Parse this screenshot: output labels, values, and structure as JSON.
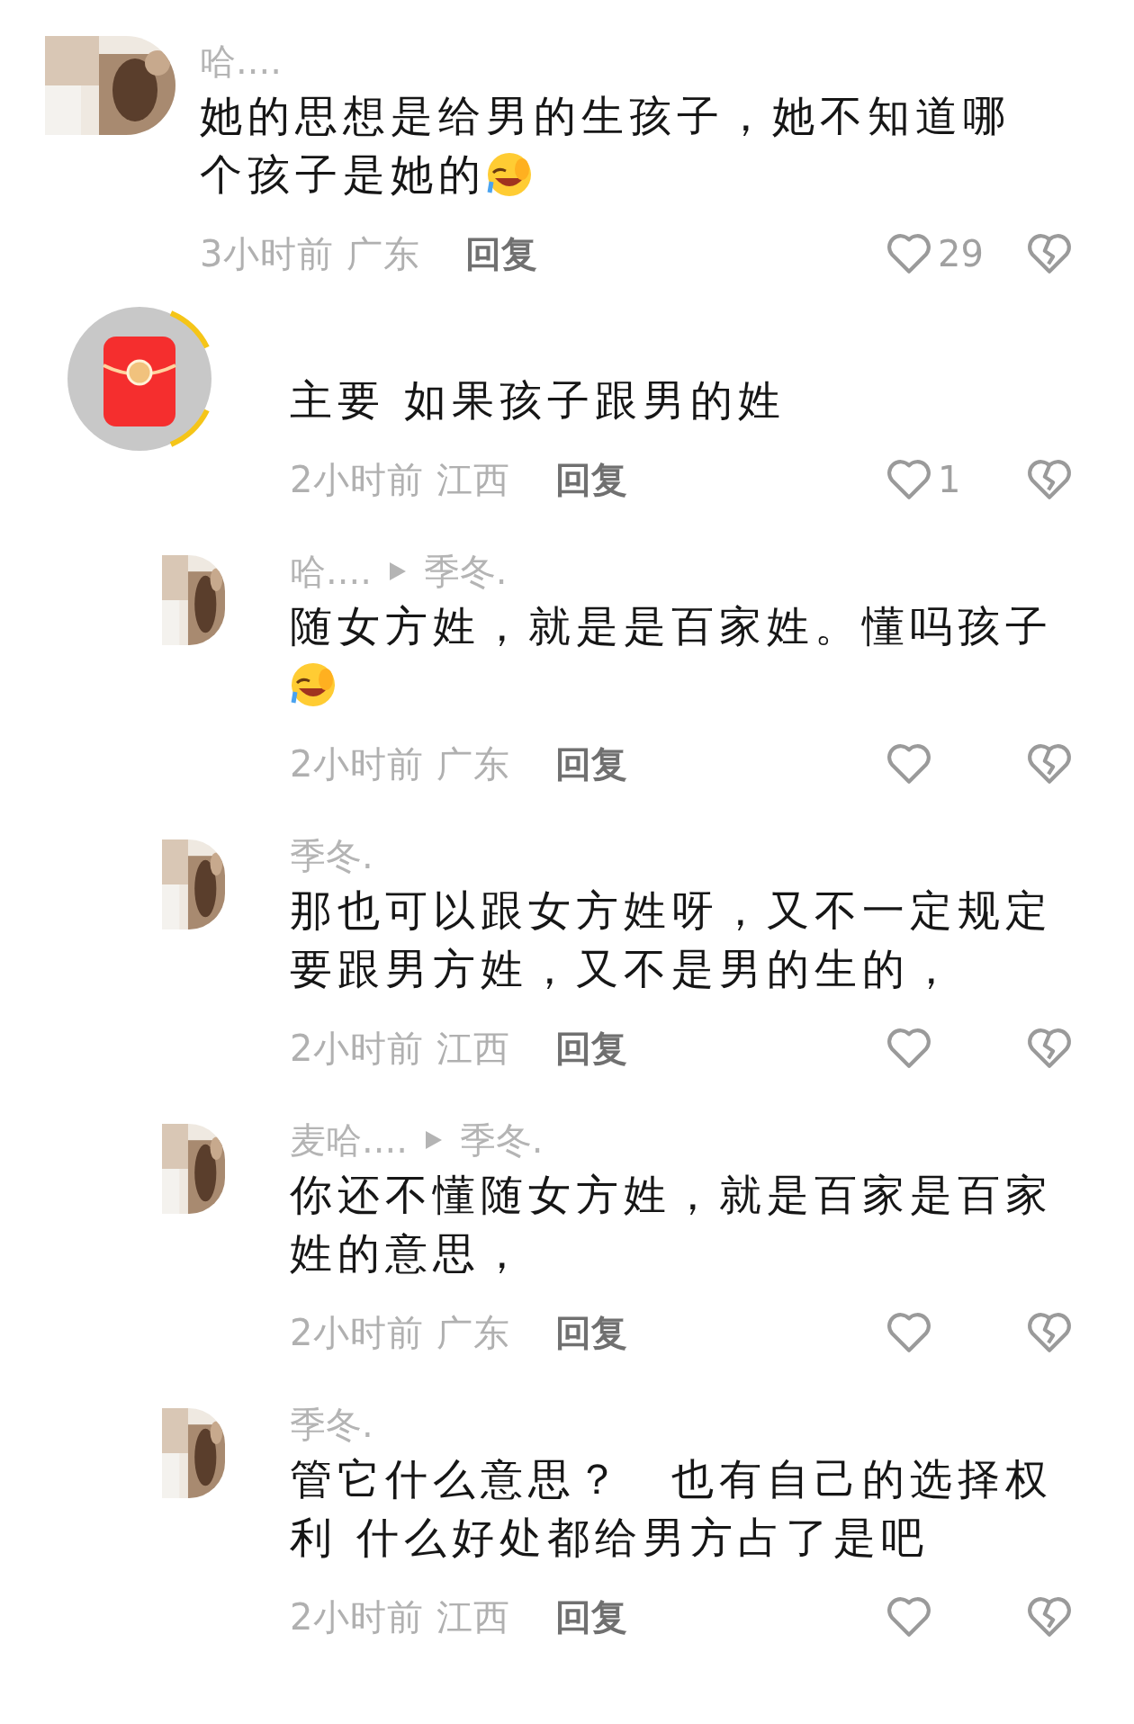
{
  "comments": [
    {
      "kind": "comment",
      "author": "哈....",
      "text": "她的思想是给男的生孩子，她不知道哪个孩子是她的",
      "emoji": true,
      "time": "3小时前",
      "location": "广东",
      "reply_label": "回复",
      "likes": "29"
    },
    {
      "kind": "reply",
      "avatar": {
        "kind": "envelope"
      },
      "text": "主要 如果孩子跟男的姓",
      "emoji": false,
      "time": "2小时前",
      "location": "江西",
      "reply_label": "回复",
      "likes": "1"
    },
    {
      "kind": "reply",
      "author": "哈....",
      "reply_to": "季冬.",
      "text": "随女方姓，就是是百家姓。懂吗孩子",
      "emoji": true,
      "time": "2小时前",
      "location": "广东",
      "reply_label": "回复"
    },
    {
      "kind": "reply",
      "author": "季冬.",
      "text": "那也可以跟女方姓呀，又不一定规定要跟男方姓，又不是男的生的，",
      "emoji": false,
      "time": "2小时前",
      "location": "江西",
      "reply_label": "回复"
    },
    {
      "kind": "reply",
      "author": "麦哈....",
      "reply_to": "季冬.",
      "text": "你还不懂随女方姓，就是百家是百家姓的意思，",
      "emoji": false,
      "time": "2小时前",
      "location": "广东",
      "reply_label": "回复"
    },
    {
      "kind": "reply",
      "author": "季冬.",
      "text": "管它什么意思？　也有自己的选择权利 什么好处都给男方占了是吧",
      "emoji": false,
      "time": "2小时前",
      "location": "江西",
      "reply_label": "回复"
    }
  ]
}
